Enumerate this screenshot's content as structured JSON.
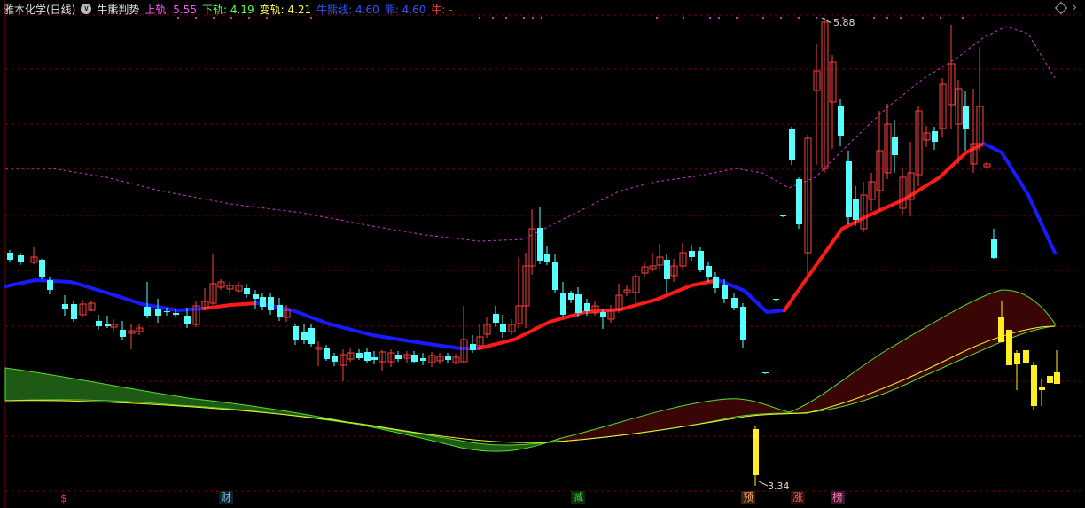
{
  "header": {
    "title": "雅本化学(日线)",
    "indicator": "牛熊判势",
    "upper_label": "上轨:",
    "upper_value": "5.55",
    "lower_label": "下轨:",
    "lower_value": "4.19",
    "change_label": "变轨:",
    "change_value": "4.21",
    "bull_bear_label": "牛熊线:",
    "bull_bear_value": "4.60",
    "bear_label": "熊:",
    "bear_value": "4.60",
    "bull_label": "牛:",
    "bull_value": "-"
  },
  "nav": {
    "right_arrow": "›"
  },
  "annotations": {
    "high": "5.88",
    "low": "3.34"
  },
  "markers": [
    {
      "text": "$",
      "color": "#ff2a2a",
      "bg": "#000"
    },
    {
      "text": "财",
      "color": "#7ab8ff",
      "bg": "#122"
    },
    {
      "text": "减",
      "color": "#33cc33",
      "bg": "#0d2a0d"
    },
    {
      "text": "预",
      "color": "#ffb070",
      "bg": "#3a2010"
    },
    {
      "text": "涨",
      "color": "#ff5a5a",
      "bg": "#2a0e0e"
    },
    {
      "text": "榜",
      "color": "#ff7ab0",
      "bg": "#3a1830"
    }
  ],
  "colors": {
    "up": "#ff4040",
    "down": "#55ffff",
    "bull_line": "#ff1a1a",
    "bear_line": "#1a1aff",
    "band": "#cc33cc",
    "grid": "#7a0000"
  },
  "chart_data": {
    "type": "candlestick",
    "title": "雅本化学(日线)",
    "ylim": [
      3.2,
      6.0
    ],
    "series": [
      {
        "name": "牛熊线",
        "values": [
          4.45,
          4.47,
          4.49,
          4.48,
          4.47,
          4.44,
          4.4,
          4.33,
          4.25,
          4.18,
          4.1,
          4.05,
          4.03,
          4.06,
          4.15,
          4.28,
          4.38,
          4.44,
          4.42,
          4.47,
          4.52,
          4.57,
          4.52,
          4.38,
          4.32,
          4.48,
          4.78,
          5.0,
          5.06,
          5.14,
          5.22,
          5.26,
          5.05,
          4.62
        ]
      }
    ],
    "high_label": 5.88,
    "low_label": 3.34
  }
}
